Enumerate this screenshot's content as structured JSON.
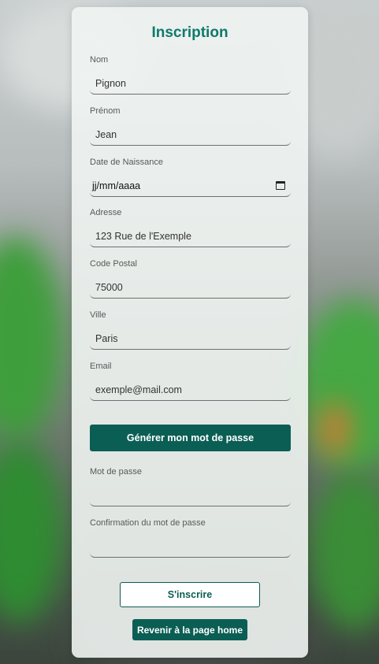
{
  "form": {
    "title": "Inscription",
    "fields": [
      {
        "label": "Nom",
        "value": "Pignon"
      },
      {
        "label": "Prénom",
        "value": "Jean"
      },
      {
        "label": "Date de Naissance",
        "value": "jj/mm/aaaa"
      },
      {
        "label": "Adresse",
        "value": "123 Rue de l'Exemple"
      },
      {
        "label": "Code Postal",
        "value": "75000"
      },
      {
        "label": "Ville",
        "value": "Paris"
      },
      {
        "label": "Email",
        "value": "exemple@mail.com"
      },
      {
        "label": "Mot de passe",
        "value": ""
      },
      {
        "label": "Confirmation du mot de passe",
        "value": ""
      }
    ],
    "generate_password_label": "Générer mon mot de passe",
    "submit_label": "S'inscrire",
    "home_label": "Revenir à la page home"
  },
  "colors": {
    "accent": "#0b5e54",
    "title": "#0e7a6a"
  },
  "icons": {
    "date_picker": "calendar-icon"
  }
}
